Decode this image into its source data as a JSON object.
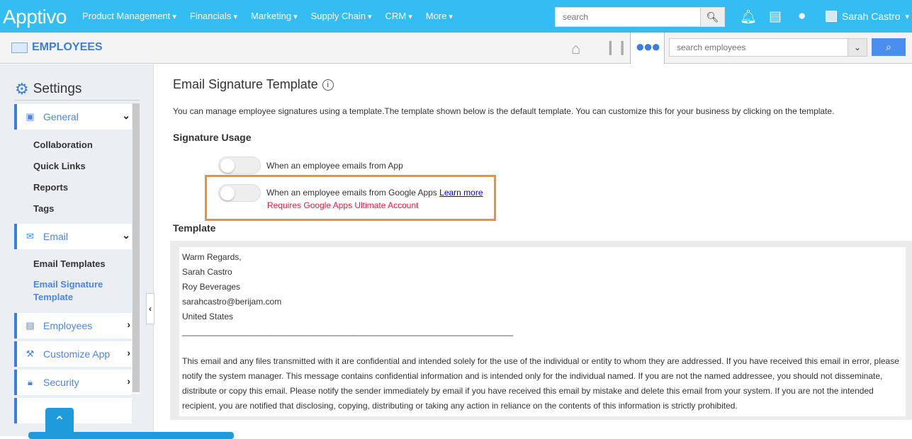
{
  "topbar": {
    "logo": "Apptivo",
    "nav": [
      "Product Management",
      "Financials",
      "Marketing",
      "Supply Chain",
      "CRM",
      "More"
    ],
    "search_placeholder": "search",
    "user": "Sarah Castro"
  },
  "subbar": {
    "module": "EMPLOYEES",
    "search_placeholder": "search employees"
  },
  "sidebar": {
    "title": "Settings",
    "sections": [
      {
        "label": "General",
        "subs": [
          "Collaboration",
          "Quick Links",
          "Reports",
          "Tags"
        ]
      },
      {
        "label": "Email",
        "subs": [
          "Email Templates",
          "Email Signature Template"
        ]
      },
      {
        "label": "Employees"
      },
      {
        "label": "Customize App"
      },
      {
        "label": "Security"
      }
    ]
  },
  "main": {
    "title": "Email Signature Template",
    "description": "You can manage employee signatures using a template.The template shown below is the default template. You can customize this for your business by clicking on the template.",
    "usage_heading": "Signature Usage",
    "toggle_app": "When an employee emails from App",
    "toggle_google": "When an employee emails from Google Apps",
    "learn_more": "Learn more",
    "google_warning": "Requires Google Apps Ultimate Account",
    "template_heading": "Template",
    "template_lines": [
      "Warm Regards,",
      "Sarah  Castro",
      "Roy Beverages",
      "sarahcastro@berijam.com",
      "United States",
      "______________________________________________________________________"
    ],
    "disclaimer": "This email and any files transmitted with it are confidential and intended solely for the use of the individual or entity to whom they are addressed. If you have received this email in error, please notify the system manager. This message contains confidential information and is intended only for the individual named. If you are not the named addressee, you should not disseminate, distribute or copy this email. Please notify the sender immediately by email if you have received this email by mistake and delete this email from your system. If you are not the intended recipient, you are notified that disclosing, copying, distributing or taking any action in reliance on the contents of this information is strictly prohibited."
  },
  "colors": {
    "topbar": "#33bdf2",
    "accent": "#3d7de0",
    "highlight": "#e9923a",
    "warning": "#f0143c"
  }
}
